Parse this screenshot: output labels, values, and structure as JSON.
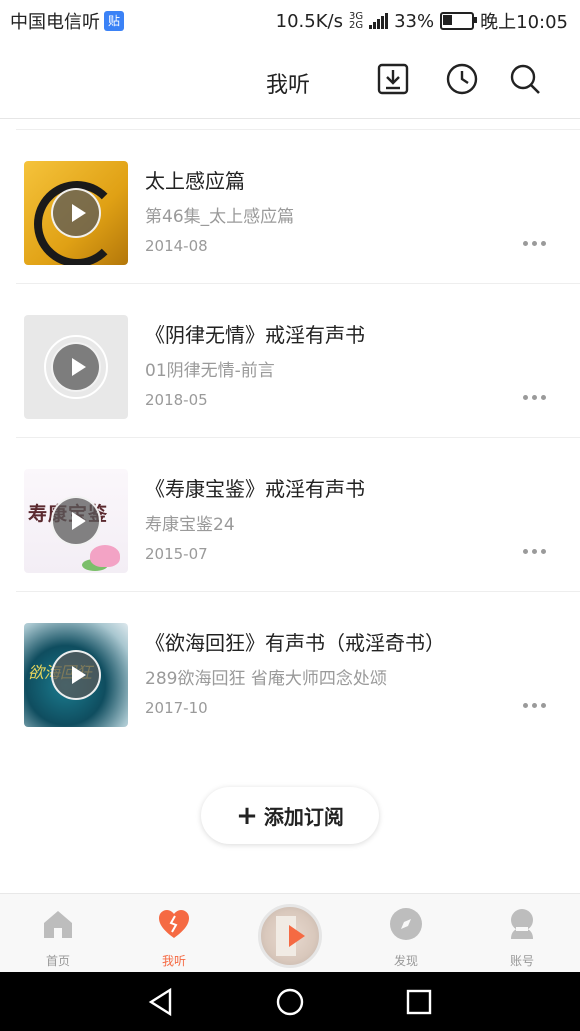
{
  "status_bar": {
    "carrier": "中国电信听",
    "badge": "贴",
    "network_speed": "10.5K/s",
    "network_type_top": "3G",
    "network_type_bottom": "2G",
    "battery": "33%",
    "battery_level": 0.33,
    "time": "晚上10:05"
  },
  "header": {
    "title": "我听",
    "icons": [
      "download-icon",
      "history-clock-icon",
      "search-icon"
    ]
  },
  "items": [
    {
      "title": "太上感应篇",
      "subtitle": "第46集_太上感应篇",
      "date": "2014-08"
    },
    {
      "title": "《阴律无情》戒淫有声书",
      "subtitle": "01阴律无情-前言",
      "date": "2018-05"
    },
    {
      "title": "《寿康宝鉴》戒淫有声书",
      "subtitle": "寿康宝鉴24",
      "date": "2015-07",
      "cover_text": "寿康宝鉴"
    },
    {
      "title": "《欲海回狂》有声书（戒淫奇书）",
      "subtitle": "289欲海回狂 省庵大师四念处颂",
      "date": "2017-10",
      "cover_text": "欲海回狂"
    }
  ],
  "add_subscription": {
    "plus": "+",
    "label": "添加订阅"
  },
  "bottom_nav": {
    "items": [
      {
        "label": "首页",
        "icon": "home-icon"
      },
      {
        "label": "我听",
        "icon": "heart-icon",
        "active": true
      },
      {
        "label": "",
        "icon": "now-playing-disc"
      },
      {
        "label": "发现",
        "icon": "compass-icon"
      },
      {
        "label": "账号",
        "icon": "account-icon"
      }
    ]
  },
  "colors": {
    "accent": "#f56a43",
    "muted_text": "#9a9a9a",
    "nav_inactive": "#bbbbbb"
  }
}
